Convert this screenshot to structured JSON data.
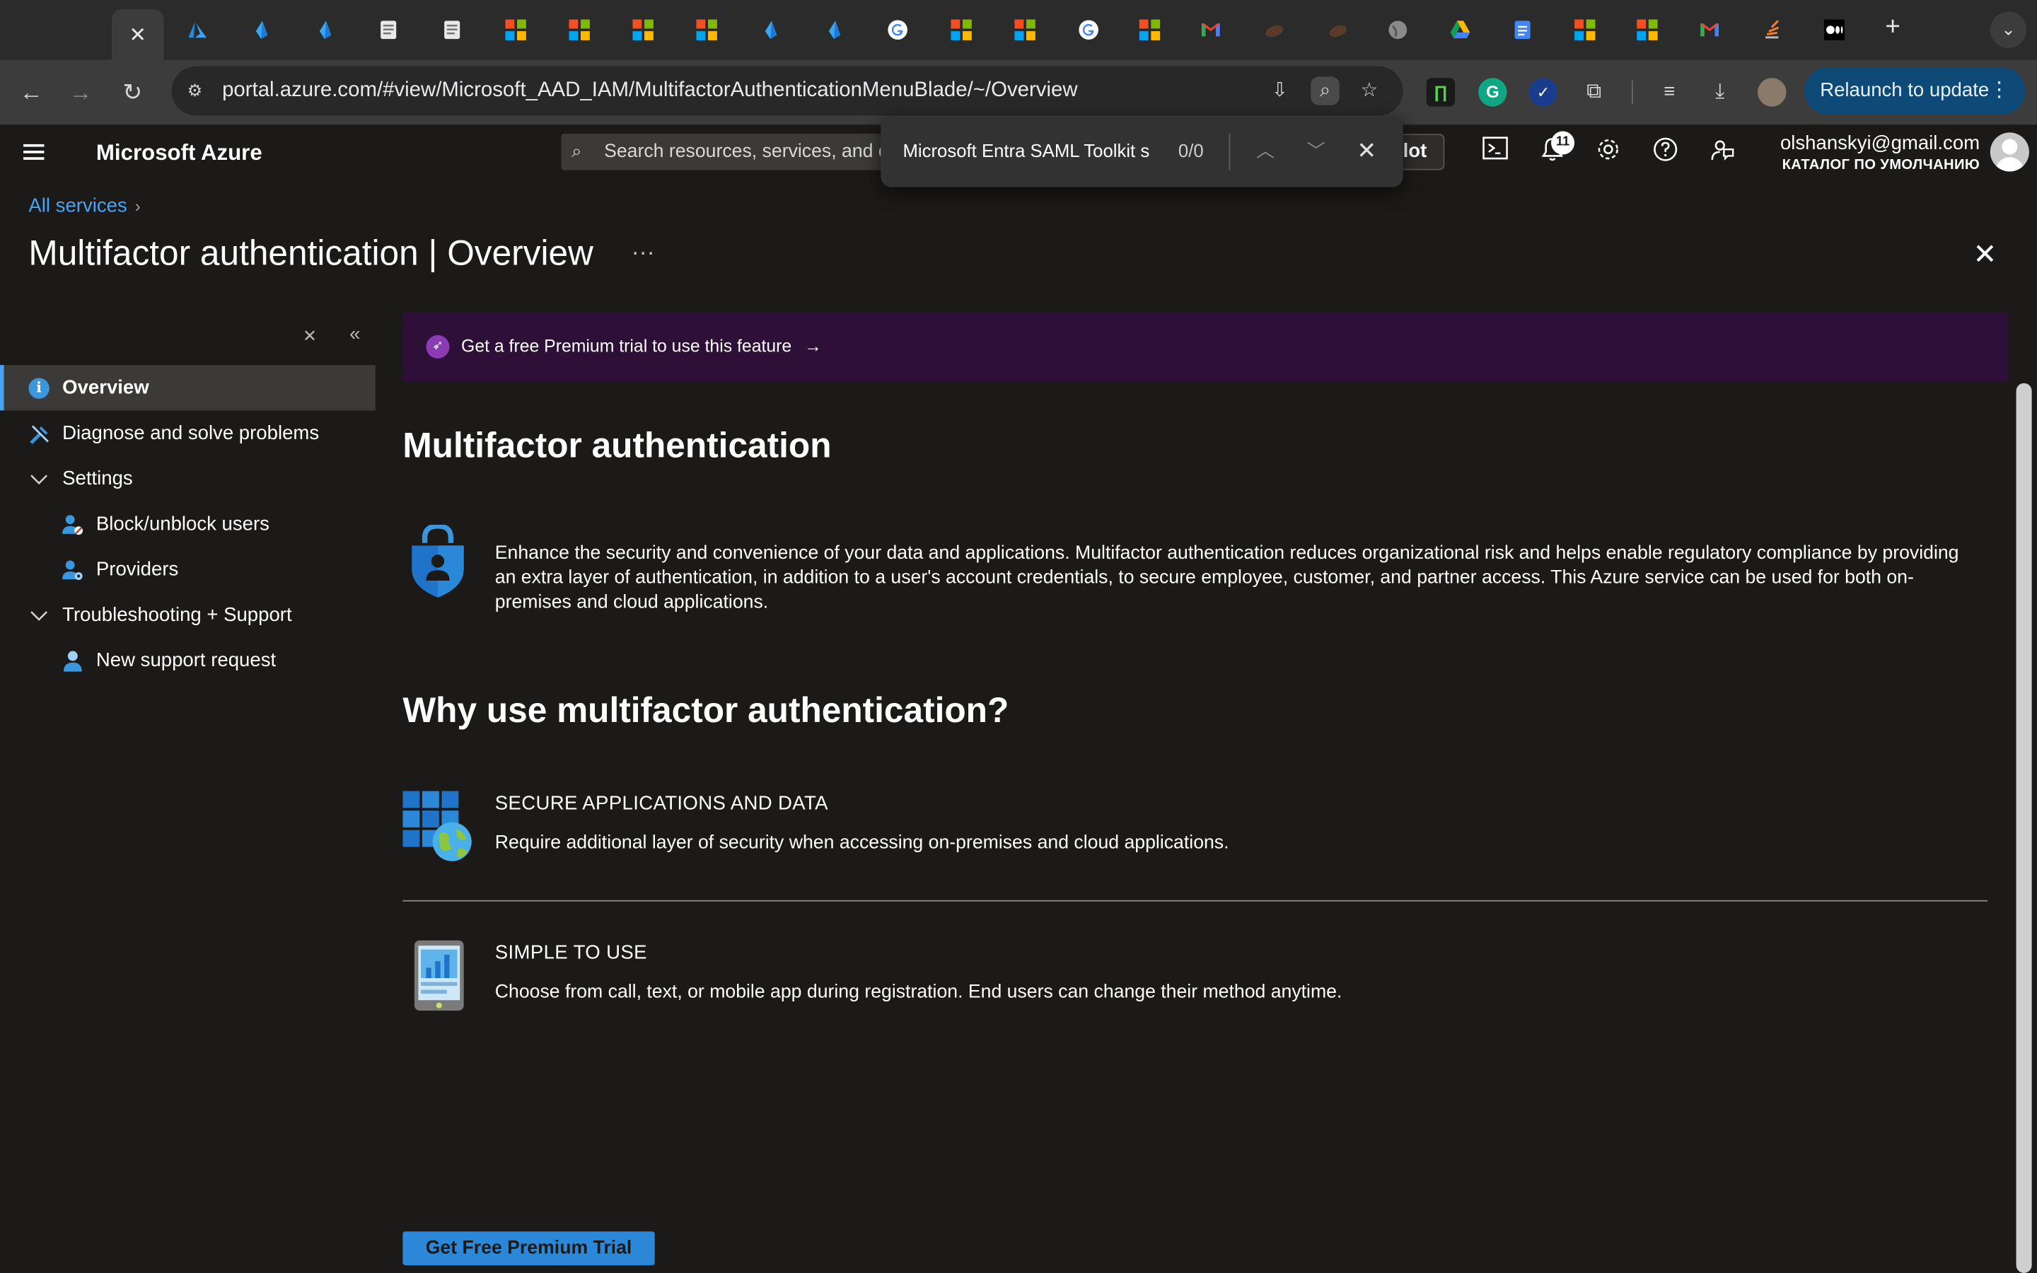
{
  "browser": {
    "active_tab_close": "✕",
    "new_tab": "+",
    "tab_menu": "⌄",
    "address": "portal.azure.com/#view/Microsoft_AAD_IAM/MultifactorAuthenticationMenuBlade/~/Overview",
    "relaunch_label": "Relaunch to update"
  },
  "azure_header": {
    "brand": "Microsoft Azure",
    "search_placeholder": "Search resources, services, and do",
    "copilot_fragment": "lot",
    "notification_count": "11",
    "account_email": "olshanskyi@gmail.com",
    "account_directory": "КАТАЛОГ ПО УМОЛЧАНИЮ"
  },
  "find_bar": {
    "query": "Microsoft Entra SAML Toolkit s",
    "count": "0/0"
  },
  "breadcrumb": {
    "root": "All services"
  },
  "page": {
    "title_main": "Multifactor authentication",
    "title_separator": " | ",
    "title_section": "Overview",
    "more": "···"
  },
  "sidebar": {
    "items": [
      {
        "label": "Overview",
        "icon": "info-icon",
        "active": true
      },
      {
        "label": "Diagnose and solve problems",
        "icon": "wrench-icon"
      },
      {
        "label": "Settings",
        "icon": "chevron-down-icon"
      },
      {
        "label": "Block/unblock users",
        "icon": "user-block-icon"
      },
      {
        "label": "Providers",
        "icon": "user-settings-icon"
      },
      {
        "label": "Troubleshooting + Support",
        "icon": "chevron-down-icon"
      },
      {
        "label": "New support request",
        "icon": "support-person-icon"
      }
    ]
  },
  "banner": {
    "text": "Get a free Premium trial to use this feature",
    "arrow": "→"
  },
  "content": {
    "heading": "Multifactor authentication",
    "description": "Enhance the security and convenience of your data and applications. Multifactor authentication reduces organizational risk and helps enable regulatory compliance by providing an extra layer of authentication, in addition to a user's account credentials, to secure employee, customer, and partner access. This Azure service can be used for both on-premises and cloud applications.",
    "why_heading": "Why use multifactor authentication?",
    "features": [
      {
        "title": "SECURE APPLICATIONS AND DATA",
        "text": "Require additional layer of security when accessing on-premises and cloud applications.",
        "icon": "apps-globe-icon"
      },
      {
        "title": "SIMPLE TO USE",
        "text": "Choose from call, text, or mobile app during registration. End users can change their method anytime.",
        "icon": "mobile-phone-icon"
      }
    ],
    "cta_label": "Get Free Premium Trial"
  },
  "colors": {
    "accent": "#4aa3f2",
    "banner_bg": "#2d0f37",
    "cta": "#2b88d8",
    "background": "#1b1a19"
  }
}
